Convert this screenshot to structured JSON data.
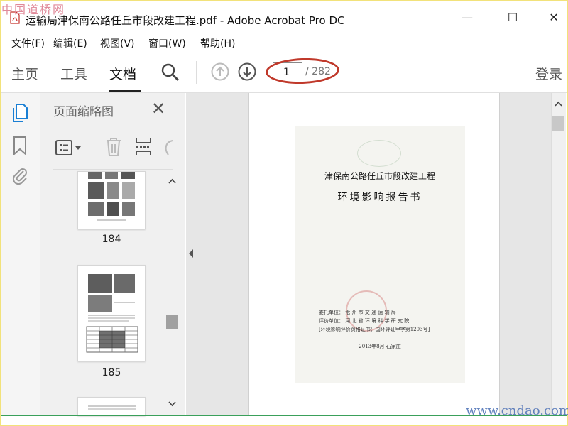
{
  "watermark_top": "中国道桥网",
  "watermark_bottom": "www.cndao.com",
  "window": {
    "title": "运输局津保南公路任丘市段改建工程.pdf - Adobe Acrobat Pro DC",
    "minimize_glyph": "—",
    "maximize_glyph": "☐",
    "close_glyph": "✕"
  },
  "menu": {
    "items": [
      "文件(F)",
      "编辑(E)",
      "视图(V)",
      "窗口(W)",
      "帮助(H)"
    ]
  },
  "toolbar": {
    "tabs": [
      "主页",
      "工具",
      "文档"
    ],
    "active_tab": "文档",
    "current_page": "1",
    "total_pages": "/ 282",
    "login": "登录"
  },
  "thumbnail_panel": {
    "title": "页面缩略图",
    "close_glyph": "✕",
    "thumbnails": [
      "184",
      "185"
    ]
  },
  "document": {
    "line1": "津保南公路任丘市段改建工程",
    "line2": "环境影响报告书",
    "client_label": "委托单位：",
    "client_value": "沧 州 市 交 通 运 输 局",
    "assessor_label": "评价单位：",
    "assessor_value": "河 北 省 环 境 科 学 研 究 院",
    "cert": "[环境影响评价资格证书：国环评证甲字第1203号]",
    "date": "2013年8月    石家庄"
  },
  "colors": {
    "accent_blue": "#1a7fd4",
    "annotation_red": "#c0392b",
    "frame_yellow": "#f2e27a"
  }
}
